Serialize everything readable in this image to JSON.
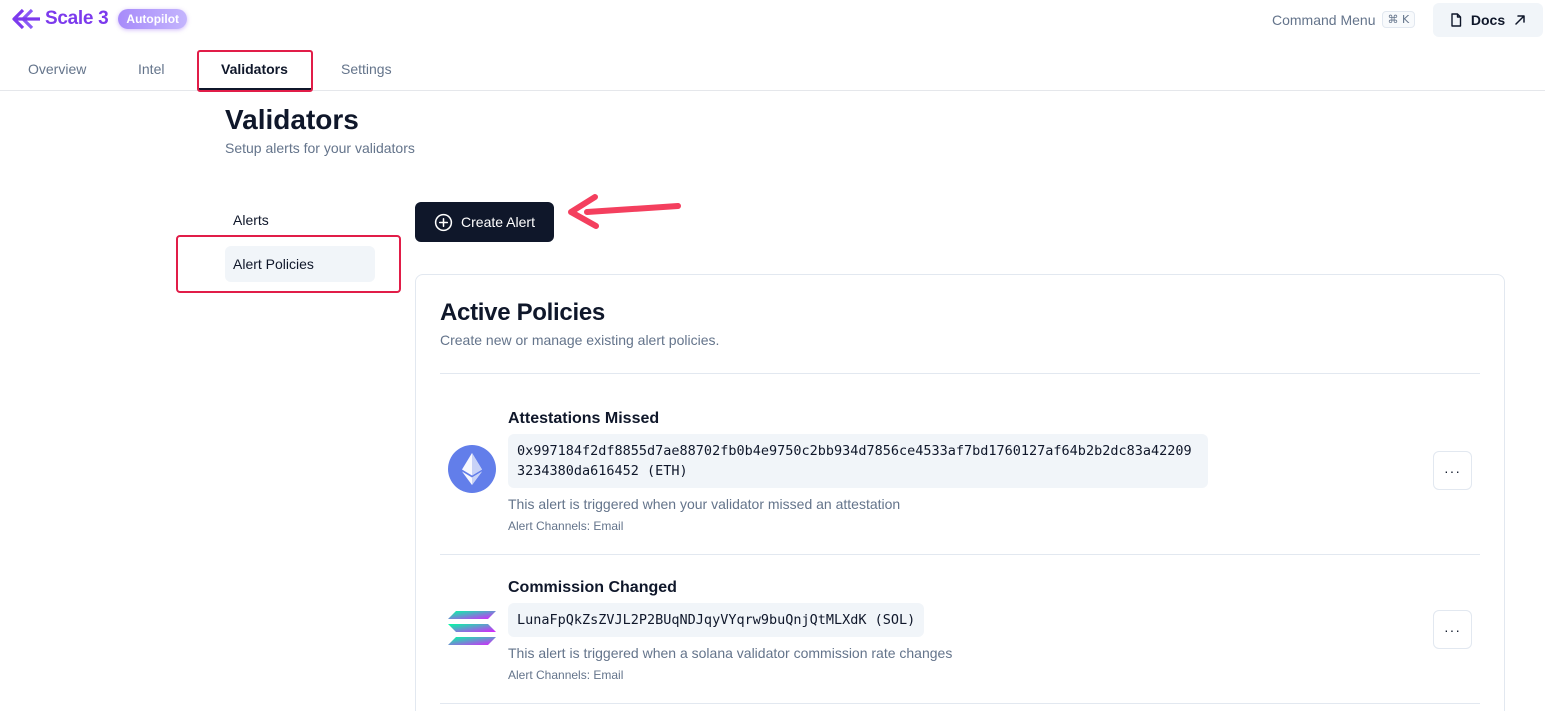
{
  "header": {
    "brand": "Scale 3",
    "badge": "Autopilot",
    "command_menu_label": "Command Menu",
    "command_menu_shortcut": "⌘ K",
    "docs_label": "Docs"
  },
  "tabs": [
    {
      "label": "Overview",
      "active": false
    },
    {
      "label": "Intel",
      "active": false
    },
    {
      "label": "Validators",
      "active": true
    },
    {
      "label": "Settings",
      "active": false
    }
  ],
  "page": {
    "title": "Validators",
    "subtitle": "Setup alerts for your validators"
  },
  "side_nav": [
    {
      "label": "Alerts",
      "selected": false
    },
    {
      "label": "Alert Policies",
      "selected": true
    }
  ],
  "create_button_label": "Create Alert",
  "card": {
    "title": "Active Policies",
    "subtitle": "Create new or manage existing alert policies."
  },
  "policies": [
    {
      "title": "Attestations Missed",
      "address": "0x997184f2df8855d7ae88702fb0b4e9750c2bb934d7856ce4533af7bd1760127af64b2b2dc83a422093234380da616452 (ETH)",
      "description": "This alert is triggered when your validator missed an attestation",
      "channels": "Alert Channels: Email",
      "icon": "ethereum-icon",
      "more_label": "···"
    },
    {
      "title": "Commission Changed",
      "address": "LunaFpQkZsZVJL2P2BUqNDJqyVYqrw9buQnjQtMLXdK (SOL)",
      "description": "This alert is triggered when a solana validator commission rate changes",
      "channels": "Alert Channels: Email",
      "icon": "solana-icon",
      "more_label": "···"
    }
  ],
  "colors": {
    "brand": "#7c3aed",
    "primary_button": "#0f172a",
    "highlight": "#e11d48",
    "arrow": "#f43f5e"
  }
}
